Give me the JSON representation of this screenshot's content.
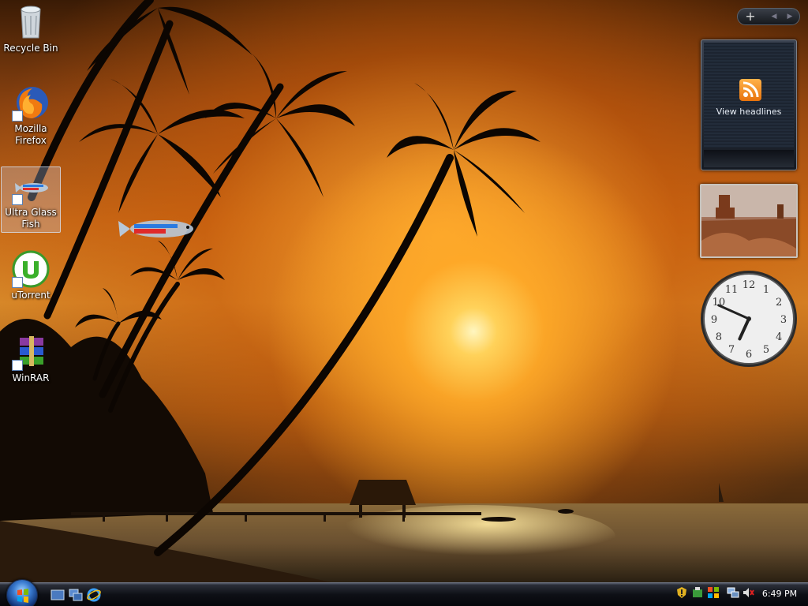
{
  "desktop": {
    "icons": [
      {
        "label": "Recycle Bin",
        "icon": "recycle-bin-icon"
      },
      {
        "label": "Mozilla Firefox",
        "icon": "firefox-icon"
      },
      {
        "label": "Ultra Glass Fish",
        "icon": "fish-icon"
      },
      {
        "label": "uTorrent",
        "icon": "utorrent-icon"
      },
      {
        "label": "WinRAR",
        "icon": "winrar-icon"
      }
    ]
  },
  "sidebar": {
    "add_label": "+",
    "prev_label": "◀",
    "next_label": "▶",
    "feed_gadget": {
      "label": "View headlines",
      "icon": "rss-icon"
    },
    "clock_gadget": {
      "numerals": [
        "12",
        "1",
        "2",
        "3",
        "4",
        "5",
        "6",
        "7",
        "8",
        "9",
        "10",
        "11"
      ],
      "hour": 6,
      "minute": 49
    }
  },
  "taskbar": {
    "start": "windows-start-orb",
    "quick_launch": [
      "show-desktop-icon",
      "switch-windows-icon",
      "internet-explorer-icon"
    ],
    "tray_icons": [
      "windows-defender-icon",
      "network-icon",
      "volume-muted-icon"
    ],
    "clock": "6:49 PM"
  },
  "colors": {
    "sky_dark": "#3a1b05",
    "sky_glow": "#d88a2a",
    "sun": "#fff6c0",
    "taskbar": "#0e1016"
  }
}
